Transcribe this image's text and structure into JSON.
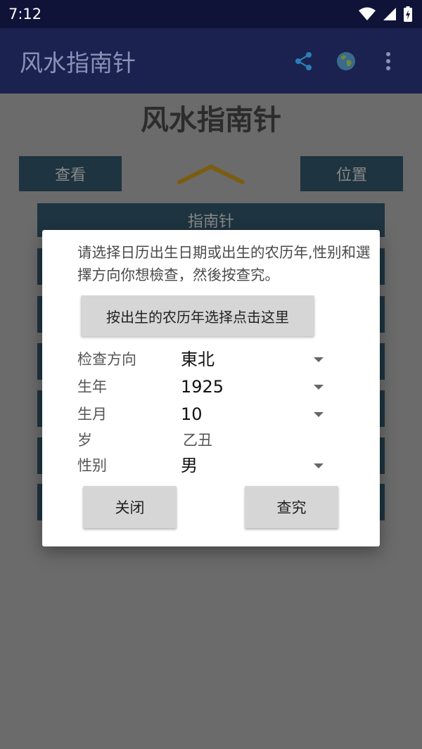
{
  "status_bar": {
    "time": "7:12"
  },
  "app_bar": {
    "title": "风水指南针",
    "icons": [
      "share-icon",
      "globe-icon",
      "more-vert-icon"
    ]
  },
  "background": {
    "title": "风水指南针",
    "view_button": "查看",
    "position_button": "位置",
    "compass_bar": "指南针"
  },
  "dialog": {
    "instruction": "请选择日历出生日期或出生的农历年,性别和選擇方向你想檢查，然後按查究。",
    "lunar_button": "按出生的农历年选择点击这里",
    "fields": [
      {
        "label": "检查方向",
        "value": "東北"
      },
      {
        "label": "生年",
        "value": "1925"
      },
      {
        "label": "生月",
        "value": "10"
      },
      {
        "label": "岁",
        "value": "乙丑"
      },
      {
        "label": "性别",
        "value": "男"
      }
    ],
    "close_button": "关闭",
    "check_button": "查究"
  },
  "colors": {
    "status_bar": "#0f1338",
    "app_bar": "#1b224f",
    "dark_button": "#1e3440",
    "chevron": "#7a5d12"
  }
}
